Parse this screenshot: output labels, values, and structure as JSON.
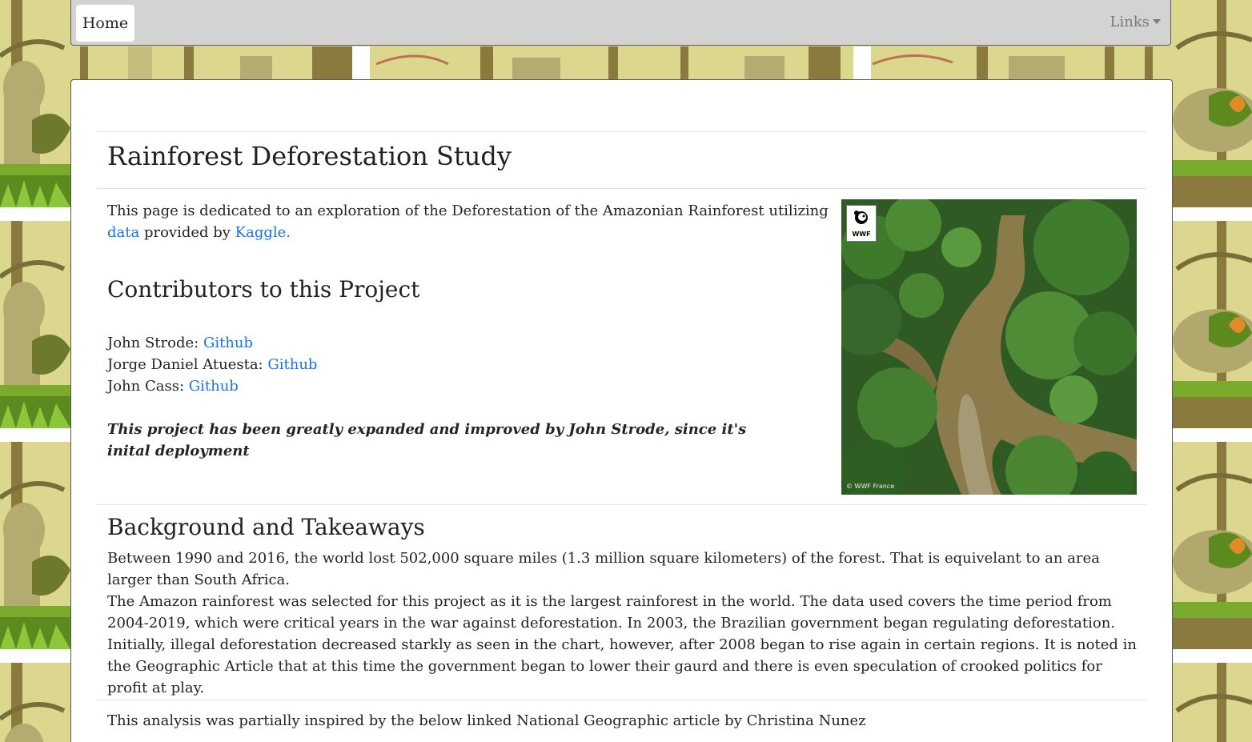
{
  "navbar": {
    "home_label": "Home",
    "links_label": "Links"
  },
  "page": {
    "title": "Rainforest Deforestation Study",
    "intro_before": "This page is dedicated to an exploration of the Deforestation of the Amazonian Rainforest utilizing ",
    "intro_link_data": "data",
    "intro_middle": " provided by ",
    "intro_link_kaggle": "Kaggle."
  },
  "contributors": {
    "heading": "Contributors to this Project",
    "people": [
      {
        "name": "John Strode: ",
        "link": "Github"
      },
      {
        "name": "Jorge Daniel Atuesta: ",
        "link": "Github"
      },
      {
        "name": "John Cass: ",
        "link": "Github"
      }
    ],
    "note": "This project has been greatly expanded and improved by John Strode, since it's inital deployment"
  },
  "photo": {
    "logo_text": "WWF",
    "credit": "© WWF France"
  },
  "background": {
    "heading": "Background and Takeaways",
    "paragraph1": "Between 1990 and 2016, the world lost 502,000 square miles (1.3 million square kilometers) of the forest. That is equivelant to an area larger than South Africa.",
    "paragraph2": "The Amazon rainforest was selected for this project as it is the largest rainforest in the world. The data used covers the time period from 2004-2019, which were critical years in the war against deforestation. In 2003, the Brazilian government began regulating deforestation. Initially, illegal deforestation decreased starkly as seen in the chart, however, after 2008 began to rise again in certain regions. It is noted in the Geographic Article that at this time the government began to lower their gaurd and there is even speculation of crooked politics for profit at play."
  },
  "footer_text": "This analysis was partially inspired by the below linked National Geographic article by Christina Nunez"
}
